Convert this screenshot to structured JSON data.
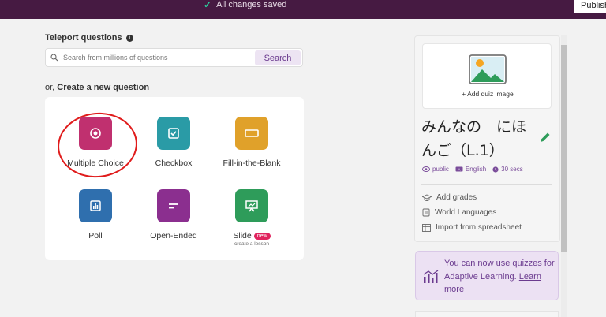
{
  "header": {
    "save_status": "All changes saved",
    "publish_label": "Publish"
  },
  "teleport": {
    "label": "Teleport questions",
    "placeholder": "Search from millions of questions",
    "search_button": "Search"
  },
  "create": {
    "prefix": "or,",
    "label": "Create a new question"
  },
  "question_types": [
    {
      "label": "Multiple Choice",
      "color": "#c0306f",
      "icon": "radio-icon"
    },
    {
      "label": "Checkbox",
      "color": "#2a9ba6",
      "icon": "checkbox-icon"
    },
    {
      "label": "Fill-in-the-Blank",
      "color": "#e0a12a",
      "icon": "blank-icon"
    },
    {
      "label": "Poll",
      "color": "#2f6fae",
      "icon": "bar-chart-icon"
    },
    {
      "label": "Open-Ended",
      "color": "#8b2f8f",
      "icon": "text-lines-icon"
    },
    {
      "label": "Slide",
      "color": "#2e9c5a",
      "icon": "presentation-icon",
      "badge": "new",
      "sub": "create a lesson"
    }
  ],
  "quiz": {
    "add_image": "+ Add quiz image",
    "title": "みんなの　にほんご（L.1）",
    "visibility": "public",
    "language": "English",
    "timer": "30 secs"
  },
  "options": {
    "grades": "Add grades",
    "subject": "World Languages",
    "import": "Import from spreadsheet"
  },
  "adaptive": {
    "text": "You can now use quizzes for Adaptive Learning.",
    "link": "Learn more"
  },
  "colors": {
    "topbar": "#461a42",
    "accent": "#6b3b8f",
    "annotation": "#e01c1c"
  }
}
